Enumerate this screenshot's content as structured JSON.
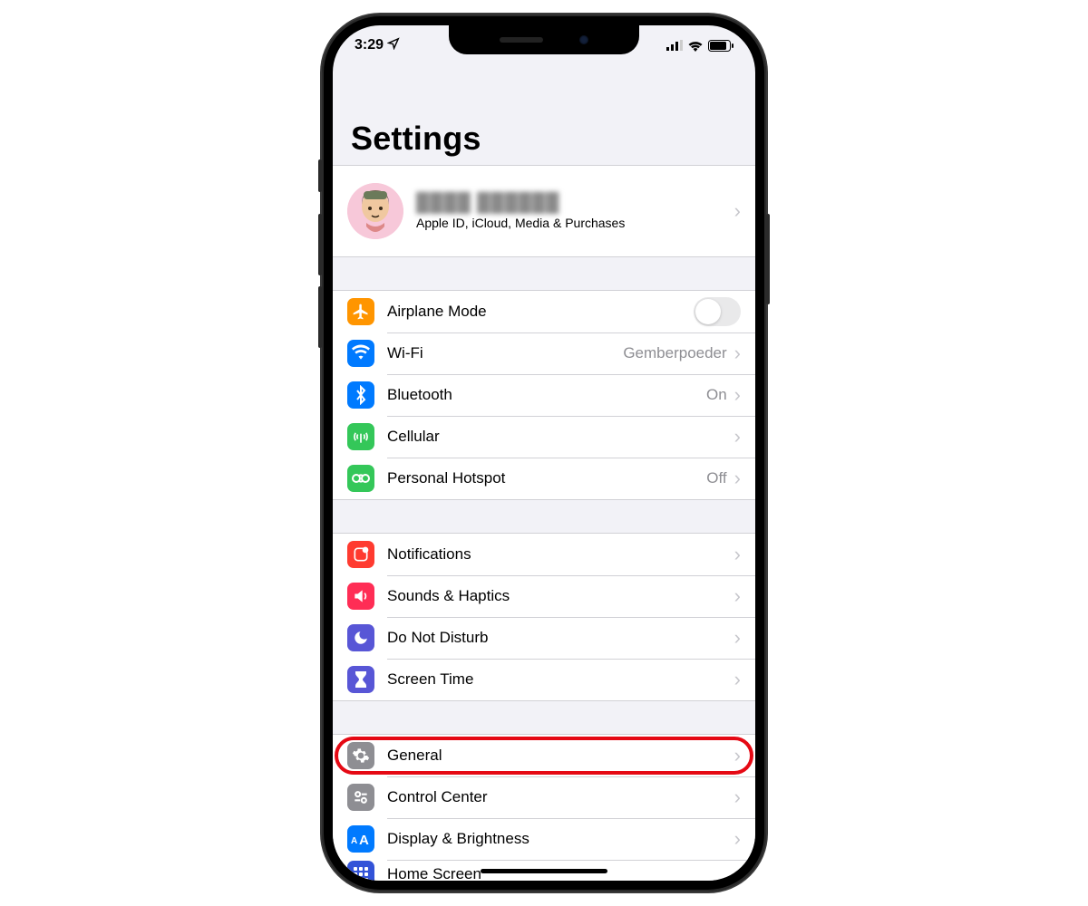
{
  "status": {
    "time": "3:29",
    "location_icon": "location",
    "signal_icon": "cellular-signal",
    "wifi_icon": "wifi-signal",
    "battery_icon": "battery"
  },
  "header": {
    "title": "Settings"
  },
  "account": {
    "name": "████ ██████",
    "subtitle": "Apple ID, iCloud, Media & Purchases"
  },
  "group1": {
    "airplane": {
      "label": "Airplane Mode",
      "icon_color": "#ff9500"
    },
    "wifi": {
      "label": "Wi-Fi",
      "detail": "Gemberpoeder",
      "icon_color": "#007aff"
    },
    "bluetooth": {
      "label": "Bluetooth",
      "detail": "On",
      "icon_color": "#007aff"
    },
    "cellular": {
      "label": "Cellular",
      "icon_color": "#34c759"
    },
    "hotspot": {
      "label": "Personal Hotspot",
      "detail": "Off",
      "icon_color": "#34c759"
    }
  },
  "group2": {
    "notifications": {
      "label": "Notifications",
      "icon_color": "#ff3b30"
    },
    "sounds": {
      "label": "Sounds & Haptics",
      "icon_color": "#ff2d55"
    },
    "dnd": {
      "label": "Do Not Disturb",
      "icon_color": "#5856d6"
    },
    "screentime": {
      "label": "Screen Time",
      "icon_color": "#5856d6"
    }
  },
  "group3": {
    "general": {
      "label": "General",
      "icon_color": "#8e8e93"
    },
    "controlcenter": {
      "label": "Control Center",
      "icon_color": "#8e8e93"
    },
    "display": {
      "label": "Display & Brightness",
      "icon_color": "#007aff"
    },
    "home": {
      "label": "Home Screen",
      "icon_color": "#3353d8"
    }
  }
}
